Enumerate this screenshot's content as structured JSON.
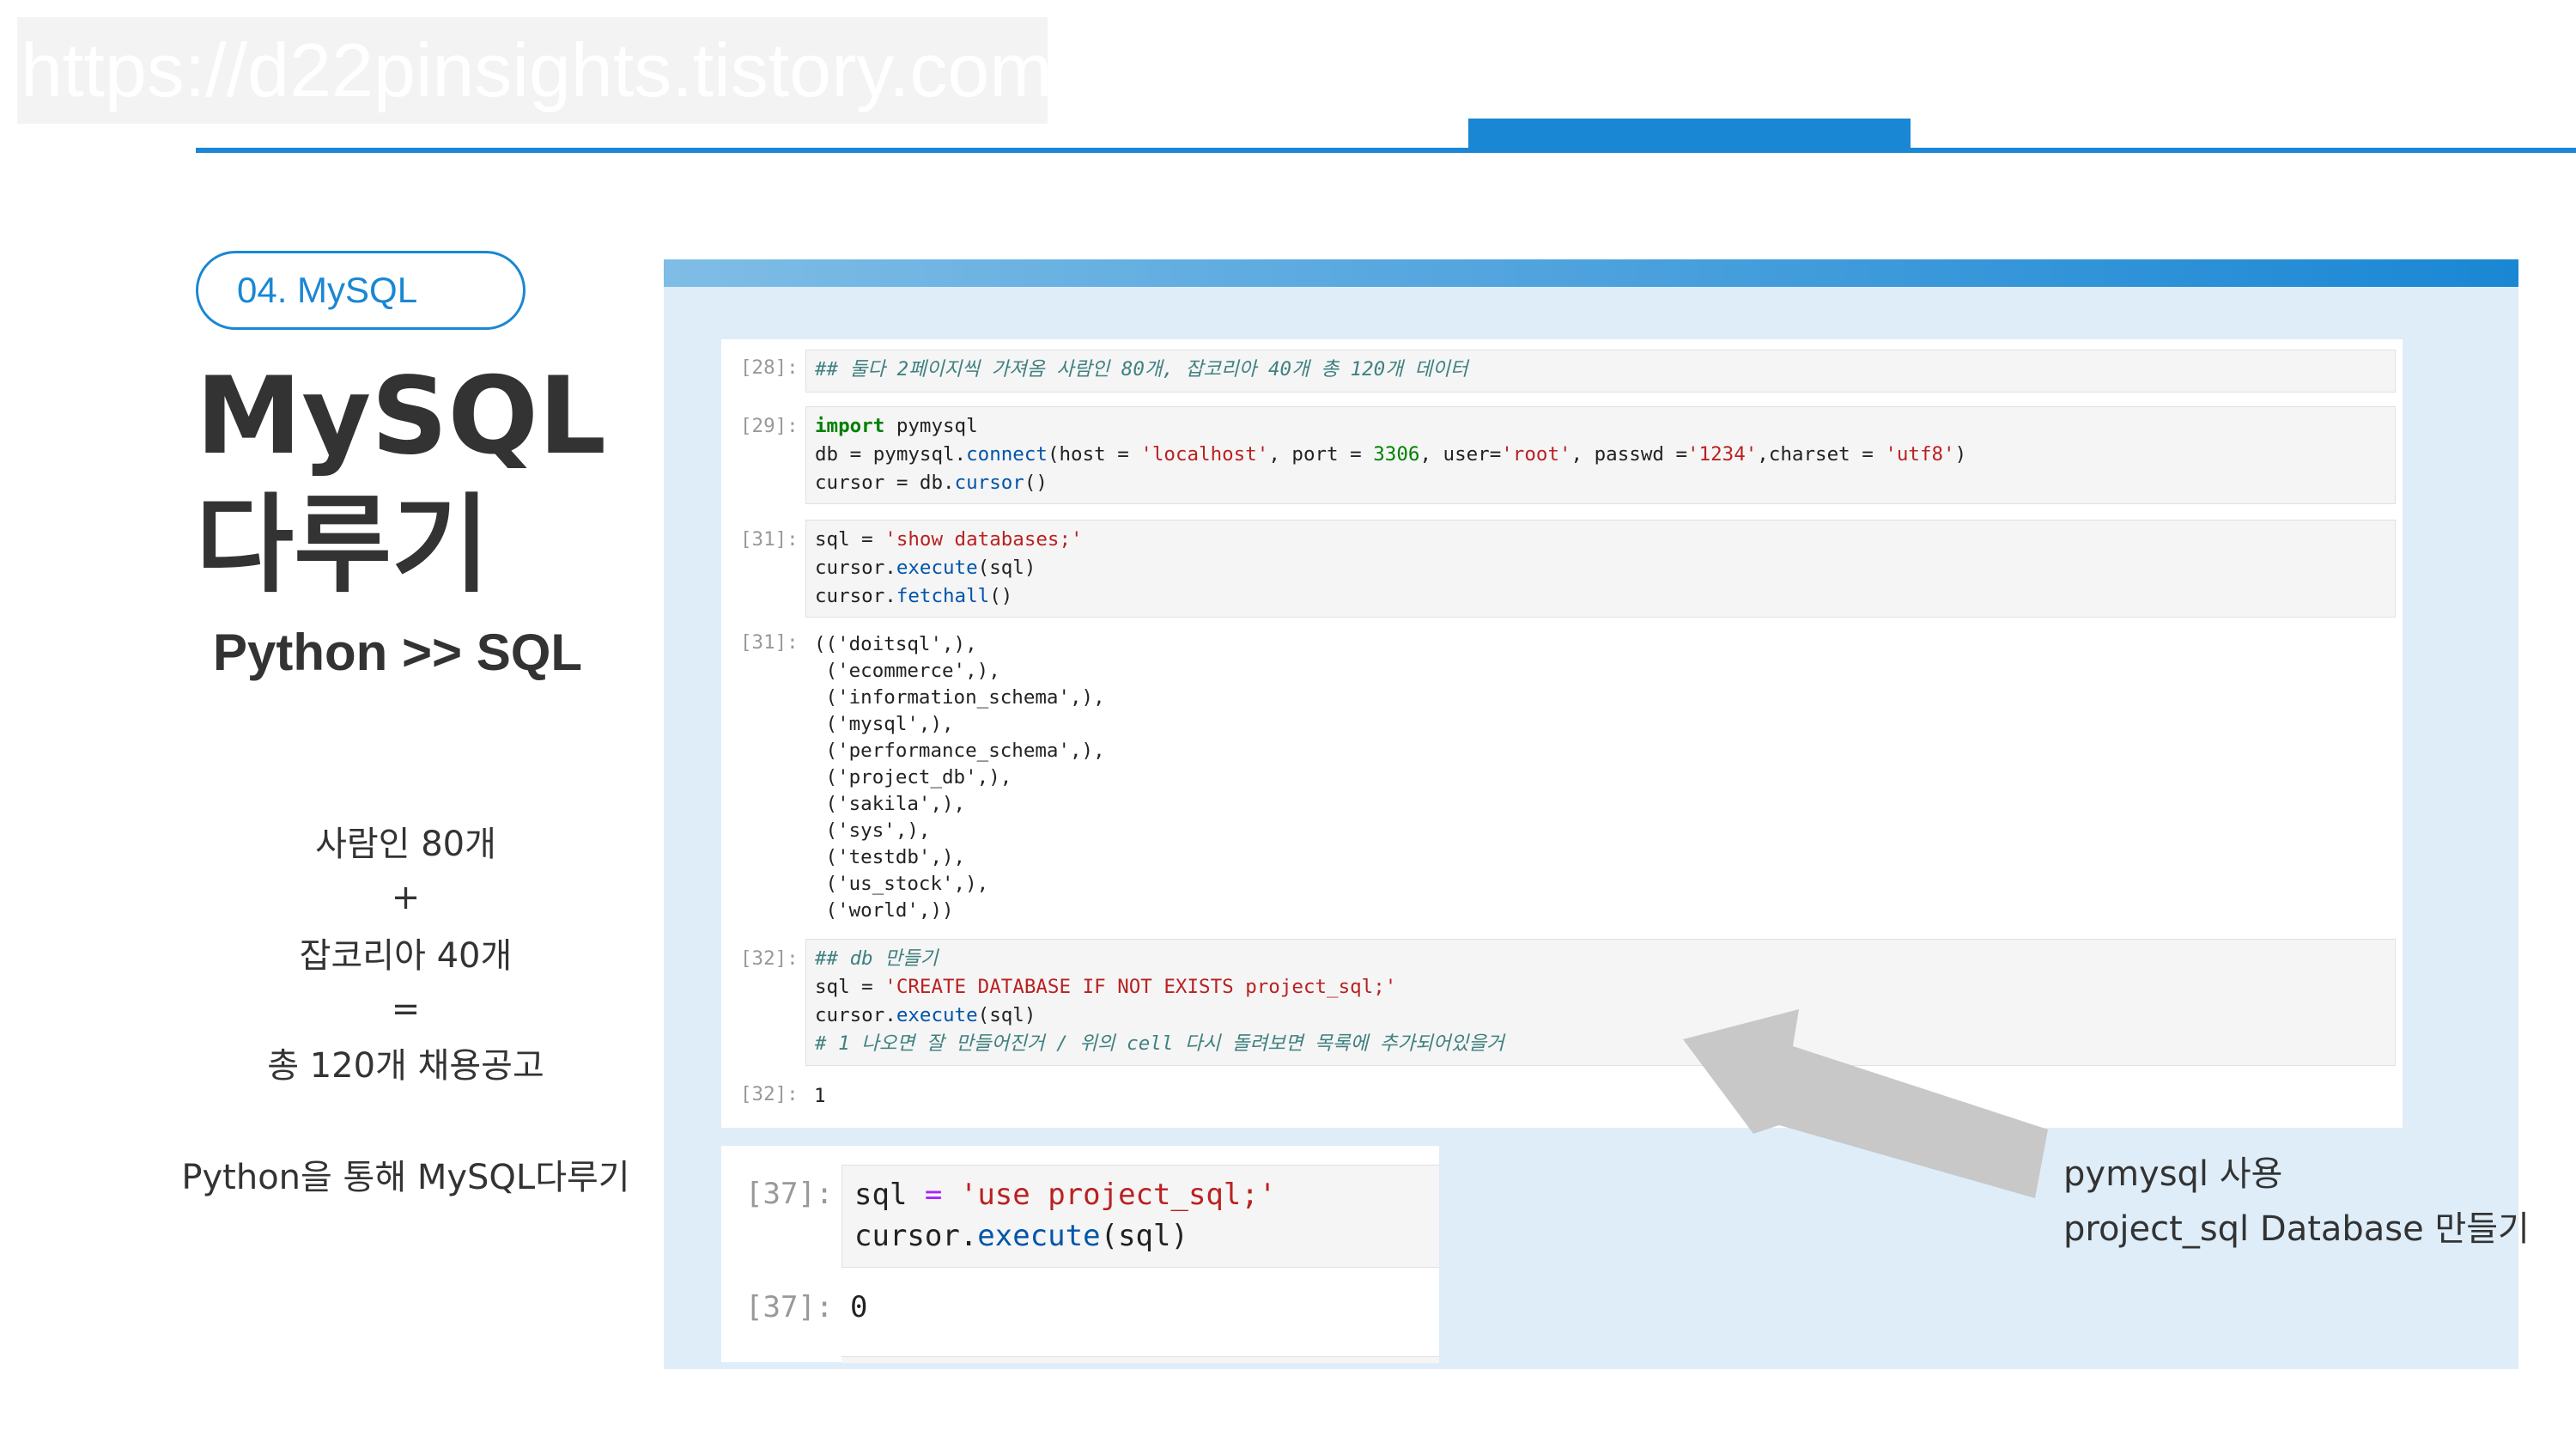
{
  "watermark": "https://d22pinsights.tistory.com",
  "section_pill": "04. MySQL",
  "title_line1": "MySQL",
  "title_line2": "다루기",
  "subtitle": "Python >> SQL",
  "summary": {
    "line1": "사람인 80개",
    "plus": "+",
    "line2": "잡코리아 40개",
    "equals": "=",
    "line3": "총 120개 채용공고",
    "line4": "Python을 통해 MySQL다루기"
  },
  "notebook": {
    "cell28": {
      "prompt": "[28]:",
      "comment": "## 둘다 2페이지씩 가져옴 사람인 80개, 잡코리아 40개 총 120개 데이터"
    },
    "cell29": {
      "prompt": "[29]:",
      "l1_kw": "import",
      "l1_mod": " pymysql",
      "l2_a": "db = pymysql.",
      "l2_fn": "connect",
      "l2_b": "(host = ",
      "l2_host": "'localhost'",
      "l2_c": ", port = ",
      "l2_port": "3306",
      "l2_d": ", user=",
      "l2_user": "'root'",
      "l2_e": ", passwd =",
      "l2_pw": "'1234'",
      "l2_f": ",charset = ",
      "l2_cs": "'utf8'",
      "l2_g": ")",
      "l3_a": "cursor = db.",
      "l3_fn": "cursor",
      "l3_b": "()"
    },
    "cell31": {
      "prompt": "[31]:",
      "l1_a": "sql = ",
      "l1_str": "'show databases;'",
      "l2_a": "cursor.",
      "l2_fn": "execute",
      "l2_b": "(sql)",
      "l3_a": "cursor.",
      "l3_fn": "fetchall",
      "l3_b": "()"
    },
    "out31": {
      "prompt": "[31]:",
      "lines": [
        "(('doitsql',),",
        " ('ecommerce',),",
        " ('information_schema',),",
        " ('mysql',),",
        " ('performance_schema',),",
        " ('project_db',),",
        " ('sakila',),",
        " ('sys',),",
        " ('testdb',),",
        " ('us_stock',),",
        " ('world',))"
      ]
    },
    "cell32": {
      "prompt": "[32]:",
      "l1_comment": "## db 만들기",
      "l2_a": "sql = ",
      "l2_str": "'CREATE DATABASE IF NOT EXISTS project_sql;'",
      "l3_a": "cursor.",
      "l3_fn": "execute",
      "l3_b": "(sql)",
      "l4_comment": "# 1 나오면 잘 만들어진거 / 위의 cell 다시 돌려보면 목록에 추가되어있을거"
    },
    "out32": {
      "prompt": "[32]:",
      "value": "1"
    }
  },
  "notebook2": {
    "cell37": {
      "prompt": "[37]:",
      "l1_a": "sql ",
      "l1_op": "=",
      "l1_sp": " ",
      "l1_str": "'use project_sql;'",
      "l2_a": "cursor.",
      "l2_fn": "execute",
      "l2_b": "(sql)"
    },
    "out37": {
      "prompt": "[37]:",
      "value": "0"
    }
  },
  "annotation": {
    "line1": "pymysql 사용",
    "line2": "project_sql Database 만들기"
  },
  "colors": {
    "accent": "#1a87d4",
    "panel": "#deedf8",
    "arrow": "#c8c8c8"
  }
}
